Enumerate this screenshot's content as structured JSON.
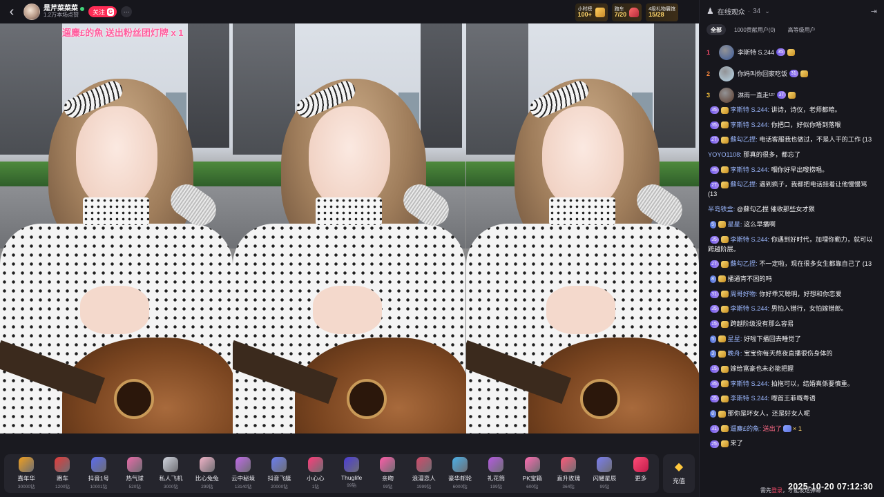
{
  "topbar": {
    "back_icon": "chevron-left-icon",
    "streamer_name": "是芹菜菜菜",
    "streamer_likes": "1.2万本场点赞",
    "follow_label": "关注",
    "fan_tag": "G",
    "more_label": "···",
    "rank_cards": [
      {
        "title": "小时榜",
        "value": "100+"
      },
      {
        "title": "跑车",
        "value": "7/20"
      },
      {
        "title": "4级礼物展馆",
        "value": "15/28"
      }
    ]
  },
  "video": {
    "banner": "遛麋£的魚 送出粉丝团灯牌 x 1"
  },
  "gifts": [
    {
      "name": "嘉年华",
      "price": "30000钻",
      "color": "#f0a020"
    },
    {
      "name": "跑车",
      "price": "1200钻",
      "color": "#e33a3a"
    },
    {
      "name": "抖音1号",
      "price": "10001钻",
      "color": "#5a6cf0"
    },
    {
      "name": "热气球",
      "price": "520钻",
      "color": "#e96aa8"
    },
    {
      "name": "私人飞机",
      "price": "3000钻",
      "color": "#d0d4de"
    },
    {
      "name": "比心兔兔",
      "price": "299钻",
      "color": "#f2b4c8"
    },
    {
      "name": "云中秘境",
      "price": "13140钻",
      "color": "#c06ae8"
    },
    {
      "name": "抖音飞艇",
      "price": "20000钻",
      "color": "#6a7ef0"
    },
    {
      "name": "小心心",
      "price": "1钻",
      "color": "#ff3c7a"
    },
    {
      "name": "Thuglife",
      "price": "99钻",
      "color": "#4a3cd6"
    },
    {
      "name": "亲吻",
      "price": "99钻",
      "color": "#ff5ca8"
    },
    {
      "name": "浪漫恋人",
      "price": "1999钻",
      "color": "#d24a6a"
    },
    {
      "name": "豪华邮轮",
      "price": "6000钻",
      "color": "#4ab0e8"
    },
    {
      "name": "礼花筒",
      "price": "199钻",
      "color": "#b45ae0"
    },
    {
      "name": "PK宝箱",
      "price": "600钻",
      "color": "#ff6ab0"
    },
    {
      "name": "直升玫瑰",
      "price": "364钻",
      "color": "#ff5a7a"
    },
    {
      "name": "闪耀星辰",
      "price": "99钻",
      "color": "#7a7ef0"
    }
  ],
  "gift_more_label": "更多",
  "recharge_label": "充值",
  "sidebar": {
    "title": "在线观众",
    "count": "34",
    "tabs": [
      "全部",
      "1000贡献用户(0)",
      "高等级用户"
    ],
    "top3": [
      {
        "rank": "1",
        "name": "李斯特 S.244",
        "level": "35",
        "rank_color": "#ff4d6d"
      },
      {
        "rank": "2",
        "name": "你妈叫你回家吃饭",
        "level": "31",
        "rank_color": "#ff8a3d"
      },
      {
        "rank": "3",
        "name": "淋雨一直走¹²⁷",
        "level": "37",
        "rank_color": "#ffc83d"
      }
    ],
    "messages": [
      {
        "level": "35",
        "user": "李斯特 S.244:",
        "text": "讲诗，诗仪，老师都暗。"
      },
      {
        "level": "35",
        "user": "李斯特 S.244:",
        "text": "你把口，好似你唔到落喉"
      },
      {
        "level": "27",
        "user": "蘇勾乙捏:",
        "text": "电话客服我也做过，不是人干的工作 (13"
      },
      {
        "level": "",
        "user": "YOYO1108:",
        "text": "那真的很多，都忘了"
      },
      {
        "level": "35",
        "user": "李斯特 S.244:",
        "text": "嗰你好早出嚟捞唱。"
      },
      {
        "level": "27",
        "user": "蘇勾乙捏:",
        "text": "遇到疯子，我都把电话挂着让他慢慢骂 (13"
      },
      {
        "level": "",
        "user": "半岛铁盒:",
        "text": "@蘇勾乙捏 催收那些女才狠"
      },
      {
        "level": "5",
        "user": "星星:",
        "text": "这么早播啊"
      },
      {
        "level": "35",
        "user": "李斯特 S.244:",
        "text": "你遇到好时代，加埋你勤力，就可以跨越阶层。"
      },
      {
        "level": "27",
        "user": "蘇勾乙捏:",
        "text": "不一定啦，现在很多女生都靠自己了 (13"
      },
      {
        "level": "8",
        "user": "",
        "text": "播通宵不困的吗"
      },
      {
        "level": "31",
        "user": "周哥好物:",
        "text": "你好乖又聪明，好想和你恋爱"
      },
      {
        "level": "35",
        "user": "李斯特 S.244:",
        "text": "男怕入错行，女怕嫁错郎。"
      },
      {
        "level": "15",
        "user": "",
        "text": "跨越阶级没有那么容易"
      },
      {
        "level": "5",
        "user": "星星:",
        "text": "好啦下播回去睡觉了"
      },
      {
        "level": "3",
        "user": "晚舟:",
        "text": "宝宝你每天熬夜直播很伤身体的"
      },
      {
        "level": "15",
        "user": "",
        "text": "嫁给富豪也未必能把握"
      },
      {
        "level": "35",
        "user": "李斯特 S.244:",
        "text": "拍拖可以，结婚真係要慎重。"
      },
      {
        "level": "35",
        "user": "李斯特 S.244:",
        "text": "嚟首王菲嘅粤语"
      },
      {
        "level": "8",
        "user": "",
        "text": "那你是坏女人，还是好女人呢"
      },
      {
        "level": "31",
        "user": "遛麋£的魚:",
        "text": "送出了",
        "mult": "× 1"
      },
      {
        "level": "25",
        "user": "",
        "text": "来了"
      }
    ],
    "footer_left": "需先",
    "footer_highlight": "登录",
    "footer_right": "，才能发送弹幕"
  },
  "datetime": "2025-10-20 07:12:30"
}
